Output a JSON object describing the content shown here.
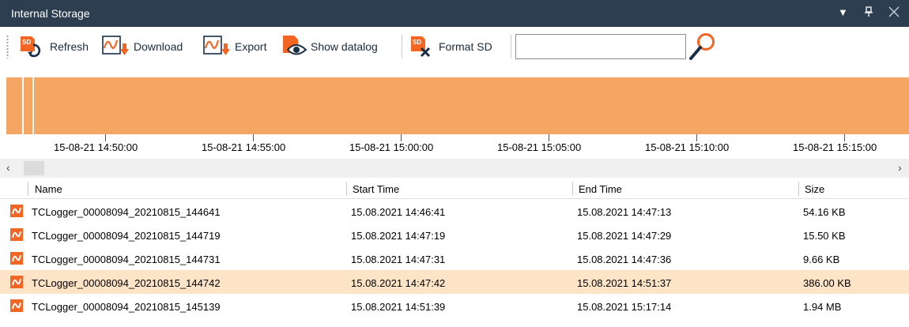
{
  "window": {
    "title": "Internal Storage"
  },
  "toolbar": {
    "refresh_label": "Refresh",
    "download_label": "Download",
    "export_label": "Export",
    "show_datalog_label": "Show datalog",
    "format_sd_label": "Format SD",
    "search_value": ""
  },
  "timeline": {
    "color": "#f4a662",
    "ticks": [
      "15-08-21 14:50:00",
      "15-08-21 14:55:00",
      "15-08-21 15:00:00",
      "15-08-21 15:05:00",
      "15-08-21 15:10:00",
      "15-08-21 15:15:00"
    ]
  },
  "table": {
    "headers": {
      "name": "Name",
      "start": "Start Time",
      "end": "End Time",
      "size": "Size"
    },
    "rows": [
      {
        "name": "TCLogger_00008094_20210815_144641",
        "start": "15.08.2021 14:46:41",
        "end": "15.08.2021 14:47:13",
        "size": "54.16 KB",
        "selected": false
      },
      {
        "name": "TCLogger_00008094_20210815_144719",
        "start": "15.08.2021 14:47:19",
        "end": "15.08.2021 14:47:29",
        "size": "15.50 KB",
        "selected": false
      },
      {
        "name": "TCLogger_00008094_20210815_144731",
        "start": "15.08.2021 14:47:31",
        "end": "15.08.2021 14:47:36",
        "size": "9.66 KB",
        "selected": false
      },
      {
        "name": "TCLogger_00008094_20210815_144742",
        "start": "15.08.2021 14:47:42",
        "end": "15.08.2021 14:51:37",
        "size": "386.00 KB",
        "selected": true
      },
      {
        "name": "TCLogger_00008094_20210815_145139",
        "start": "15.08.2021 14:51:39",
        "end": "15.08.2021 15:17:14",
        "size": "1.94 MB",
        "selected": false
      }
    ]
  },
  "colors": {
    "titlebar": "#2d3e50",
    "accent": "#f26522",
    "selected_row": "#fde4c7"
  }
}
